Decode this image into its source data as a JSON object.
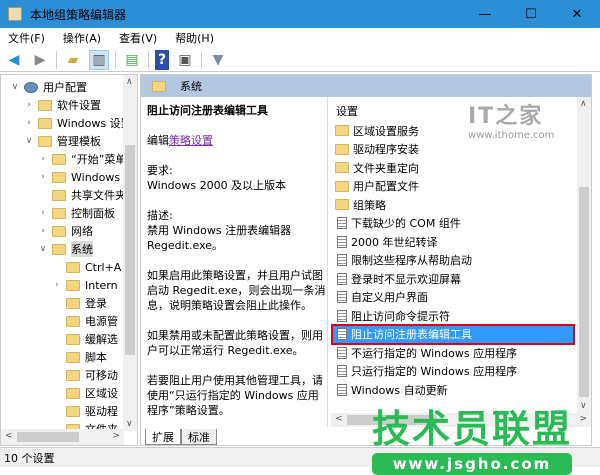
{
  "window": {
    "title": "本地组策略编辑器",
    "minimize": "—",
    "maximize": "☐",
    "close": "✕"
  },
  "menu": [
    "文件(F)",
    "操作(A)",
    "查看(V)",
    "帮助(H)"
  ],
  "toolbar": {
    "back": "back-icon",
    "forward": "forward-icon",
    "up": "folder-up-icon",
    "showhide": "show-hide-tree-icon",
    "export": "export-list-icon",
    "help": "help-icon",
    "properties": "properties-icon",
    "filter": "filter-icon"
  },
  "tree": [
    {
      "label": "用户配置",
      "level": 0,
      "chev": "v",
      "type": "user"
    },
    {
      "label": "软件设置",
      "level": 1,
      "chev": ">"
    },
    {
      "label": "Windows 设置",
      "level": 1,
      "chev": ">"
    },
    {
      "label": "管理模板",
      "level": 1,
      "chev": "v"
    },
    {
      "label": "“开始”菜单",
      "level": 2,
      "chev": ">"
    },
    {
      "label": "Windows",
      "level": 2,
      "chev": ">"
    },
    {
      "label": "共享文件夹",
      "level": 2,
      "chev": ""
    },
    {
      "label": "控制面板",
      "level": 2,
      "chev": ">"
    },
    {
      "label": "网络",
      "level": 2,
      "chev": ">"
    },
    {
      "label": "系统",
      "level": 2,
      "chev": "v",
      "selected": true
    },
    {
      "label": "Ctrl+A",
      "level": 3,
      "chev": ""
    },
    {
      "label": "Intern",
      "level": 3,
      "chev": ">"
    },
    {
      "label": "登录",
      "level": 3,
      "chev": ""
    },
    {
      "label": "电源管",
      "level": 3,
      "chev": ""
    },
    {
      "label": "缓解选",
      "level": 3,
      "chev": ""
    },
    {
      "label": "脚本",
      "level": 3,
      "chev": ""
    },
    {
      "label": "可移动",
      "level": 3,
      "chev": ""
    },
    {
      "label": "区域设",
      "level": 3,
      "chev": ""
    },
    {
      "label": "驱动程",
      "level": 3,
      "chev": ""
    },
    {
      "label": "文件夹",
      "level": 3,
      "chev": ""
    }
  ],
  "panel": {
    "header": "系统",
    "desc": {
      "title": "阻止访问注册表编辑工具",
      "edit_prefix": "编辑",
      "edit_link": "策略设置",
      "req_label": "要求:",
      "req_value": "Windows 2000 及以上版本",
      "desc_label": "描述:",
      "desc_value": "禁用 Windows 注册表编辑器 Regedit.exe。",
      "p1": "如果启用此策略设置，并且用户试图启动 Regedit.exe，则会出现一条消息，说明策略设置会阻止此操作。",
      "p2": "如果禁用或未配置此策略设置，则用户可以正常运行 Regedit.exe。",
      "p3": "若要阻止用户使用其他管理工具，请使用“只运行指定的 Windows 应用程序”策略设置。"
    },
    "list_header": "设置",
    "items": [
      {
        "label": "区域设置服务",
        "type": "folder"
      },
      {
        "label": "驱动程序安装",
        "type": "folder"
      },
      {
        "label": "文件夹重定向",
        "type": "folder"
      },
      {
        "label": "用户配置文件",
        "type": "folder"
      },
      {
        "label": "组策略",
        "type": "folder"
      },
      {
        "label": "下载缺少的 COM 组件",
        "type": "setting"
      },
      {
        "label": "2000 年世纪转译",
        "type": "setting"
      },
      {
        "label": "限制这些程序从帮助启动",
        "type": "setting"
      },
      {
        "label": "登录时不显示欢迎屏幕",
        "type": "setting"
      },
      {
        "label": "自定义用户界面",
        "type": "setting"
      },
      {
        "label": "阻止访问命令提示符",
        "type": "setting"
      },
      {
        "label": "阻止访问注册表编辑工具",
        "type": "setting",
        "selected": true
      },
      {
        "label": "不运行指定的 Windows 应用程序",
        "type": "setting"
      },
      {
        "label": "只运行指定的 Windows 应用程序",
        "type": "setting"
      },
      {
        "label": "Windows 自动更新",
        "type": "setting"
      }
    ],
    "tabs": [
      "扩展",
      "标准"
    ]
  },
  "status": "10 个设置",
  "watermarks": {
    "ithome_logo": "IT之家",
    "ithome_url": "www.ithome.com",
    "jsgho_logo": "技术员联盟",
    "jsgho_url": "www.jsgho.com"
  }
}
